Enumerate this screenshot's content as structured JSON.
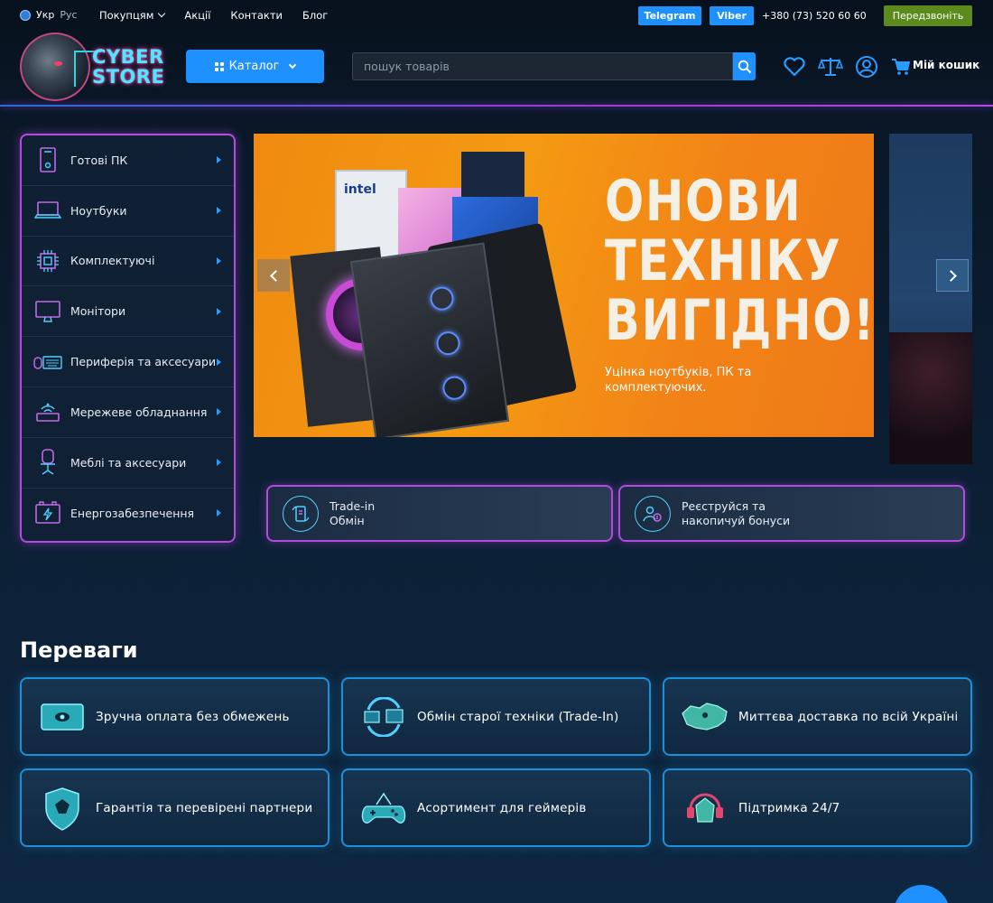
{
  "topbar": {
    "lang_current": "Укр",
    "lang_alt": "Рус",
    "nav": [
      "Покупцям",
      "Акції",
      "Контакти",
      "Блог"
    ],
    "telegram": "Telegram",
    "viber": "Viber",
    "phone": "+380 (73) 520 60 60",
    "callback": "Передзвоніть"
  },
  "header": {
    "logo_line1": "CYBER",
    "logo_line2": "STORE",
    "catalog_label": "Каталог",
    "search_placeholder": "пошук товарів",
    "cart_label": "Мій кошик"
  },
  "categories": [
    {
      "label": "Готові ПК",
      "icon": "pc-tower-icon"
    },
    {
      "label": "Ноутбуки",
      "icon": "laptop-icon"
    },
    {
      "label": "Комплектуючі",
      "icon": "cpu-chip-icon"
    },
    {
      "label": "Монітори",
      "icon": "monitor-icon"
    },
    {
      "label": "Периферія та аксесуари",
      "icon": "keyboard-mouse-icon"
    },
    {
      "label": "Мережеве обладнання",
      "icon": "router-icon"
    },
    {
      "label": "Меблі та аксесуари",
      "icon": "gaming-chair-icon"
    },
    {
      "label": "Енергозабезпечення",
      "icon": "battery-icon"
    }
  ],
  "hero": {
    "title_line1": "ОНОВИ",
    "title_line2": "ТЕХНІКУ",
    "title_line3": "ВИГІДНО!",
    "subtitle": "Уцінка ноутбуків, ПК та комплектуючих.",
    "box_brand": "intel"
  },
  "promos": [
    {
      "line1": "Trade-in",
      "line2": "Обмін",
      "icon": "trade-in-icon"
    },
    {
      "line1": "Реєструйся та",
      "line2": "накопичуй бонуси",
      "icon": "bonus-user-icon"
    }
  ],
  "advantages": {
    "title": "Переваги",
    "items": [
      {
        "label": "Зручна оплата без обмежень",
        "icon": "payment-card-icon"
      },
      {
        "label": "Обмін старої техніки (Trade-In)",
        "icon": "exchange-icon"
      },
      {
        "label": "Миттєва доставка по всій Україні",
        "icon": "ukraine-map-icon"
      },
      {
        "label": "Гарантія та перевірені партнери",
        "icon": "shield-dragon-icon"
      },
      {
        "label": "Асортимент для геймерів",
        "icon": "gamepad-dragon-icon"
      },
      {
        "label": "Підтримка 24/7",
        "icon": "headset-dragon-icon"
      }
    ]
  },
  "colors": {
    "accent_blue": "#1e90ff",
    "accent_purple": "#b44ae0",
    "callback_green": "#5b8a1d",
    "hero_orange": "#f49a12",
    "background": "#0a1726"
  }
}
